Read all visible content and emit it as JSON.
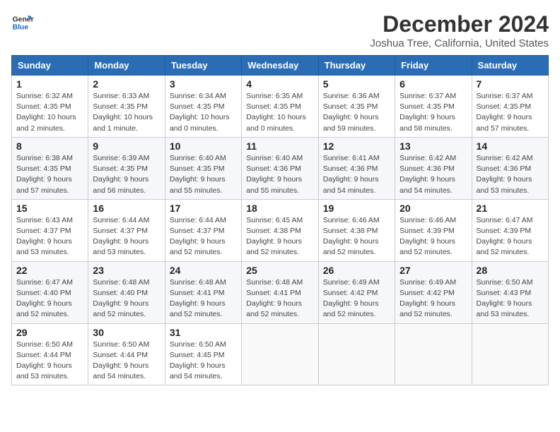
{
  "logo": {
    "line1": "General",
    "line2": "Blue"
  },
  "title": "December 2024",
  "location": "Joshua Tree, California, United States",
  "headers": [
    "Sunday",
    "Monday",
    "Tuesday",
    "Wednesday",
    "Thursday",
    "Friday",
    "Saturday"
  ],
  "weeks": [
    [
      {
        "day": "1",
        "sunrise": "6:32 AM",
        "sunset": "4:35 PM",
        "daylight": "10 hours and 2 minutes."
      },
      {
        "day": "2",
        "sunrise": "6:33 AM",
        "sunset": "4:35 PM",
        "daylight": "10 hours and 1 minute."
      },
      {
        "day": "3",
        "sunrise": "6:34 AM",
        "sunset": "4:35 PM",
        "daylight": "10 hours and 0 minutes."
      },
      {
        "day": "4",
        "sunrise": "6:35 AM",
        "sunset": "4:35 PM",
        "daylight": "10 hours and 0 minutes."
      },
      {
        "day": "5",
        "sunrise": "6:36 AM",
        "sunset": "4:35 PM",
        "daylight": "9 hours and 59 minutes."
      },
      {
        "day": "6",
        "sunrise": "6:37 AM",
        "sunset": "4:35 PM",
        "daylight": "9 hours and 58 minutes."
      },
      {
        "day": "7",
        "sunrise": "6:37 AM",
        "sunset": "4:35 PM",
        "daylight": "9 hours and 57 minutes."
      }
    ],
    [
      {
        "day": "8",
        "sunrise": "6:38 AM",
        "sunset": "4:35 PM",
        "daylight": "9 hours and 57 minutes."
      },
      {
        "day": "9",
        "sunrise": "6:39 AM",
        "sunset": "4:35 PM",
        "daylight": "9 hours and 56 minutes."
      },
      {
        "day": "10",
        "sunrise": "6:40 AM",
        "sunset": "4:35 PM",
        "daylight": "9 hours and 55 minutes."
      },
      {
        "day": "11",
        "sunrise": "6:40 AM",
        "sunset": "4:36 PM",
        "daylight": "9 hours and 55 minutes."
      },
      {
        "day": "12",
        "sunrise": "6:41 AM",
        "sunset": "4:36 PM",
        "daylight": "9 hours and 54 minutes."
      },
      {
        "day": "13",
        "sunrise": "6:42 AM",
        "sunset": "4:36 PM",
        "daylight": "9 hours and 54 minutes."
      },
      {
        "day": "14",
        "sunrise": "6:42 AM",
        "sunset": "4:36 PM",
        "daylight": "9 hours and 53 minutes."
      }
    ],
    [
      {
        "day": "15",
        "sunrise": "6:43 AM",
        "sunset": "4:37 PM",
        "daylight": "9 hours and 53 minutes."
      },
      {
        "day": "16",
        "sunrise": "6:44 AM",
        "sunset": "4:37 PM",
        "daylight": "9 hours and 53 minutes."
      },
      {
        "day": "17",
        "sunrise": "6:44 AM",
        "sunset": "4:37 PM",
        "daylight": "9 hours and 52 minutes."
      },
      {
        "day": "18",
        "sunrise": "6:45 AM",
        "sunset": "4:38 PM",
        "daylight": "9 hours and 52 minutes."
      },
      {
        "day": "19",
        "sunrise": "6:46 AM",
        "sunset": "4:38 PM",
        "daylight": "9 hours and 52 minutes."
      },
      {
        "day": "20",
        "sunrise": "6:46 AM",
        "sunset": "4:39 PM",
        "daylight": "9 hours and 52 minutes."
      },
      {
        "day": "21",
        "sunrise": "6:47 AM",
        "sunset": "4:39 PM",
        "daylight": "9 hours and 52 minutes."
      }
    ],
    [
      {
        "day": "22",
        "sunrise": "6:47 AM",
        "sunset": "4:40 PM",
        "daylight": "9 hours and 52 minutes."
      },
      {
        "day": "23",
        "sunrise": "6:48 AM",
        "sunset": "4:40 PM",
        "daylight": "9 hours and 52 minutes."
      },
      {
        "day": "24",
        "sunrise": "6:48 AM",
        "sunset": "4:41 PM",
        "daylight": "9 hours and 52 minutes."
      },
      {
        "day": "25",
        "sunrise": "6:48 AM",
        "sunset": "4:41 PM",
        "daylight": "9 hours and 52 minutes."
      },
      {
        "day": "26",
        "sunrise": "6:49 AM",
        "sunset": "4:42 PM",
        "daylight": "9 hours and 52 minutes."
      },
      {
        "day": "27",
        "sunrise": "6:49 AM",
        "sunset": "4:42 PM",
        "daylight": "9 hours and 52 minutes."
      },
      {
        "day": "28",
        "sunrise": "6:50 AM",
        "sunset": "4:43 PM",
        "daylight": "9 hours and 53 minutes."
      }
    ],
    [
      {
        "day": "29",
        "sunrise": "6:50 AM",
        "sunset": "4:44 PM",
        "daylight": "9 hours and 53 minutes."
      },
      {
        "day": "30",
        "sunrise": "6:50 AM",
        "sunset": "4:44 PM",
        "daylight": "9 hours and 54 minutes."
      },
      {
        "day": "31",
        "sunrise": "6:50 AM",
        "sunset": "4:45 PM",
        "daylight": "9 hours and 54 minutes."
      },
      null,
      null,
      null,
      null
    ]
  ],
  "labels": {
    "sunrise": "Sunrise:",
    "sunset": "Sunset:",
    "daylight": "Daylight:"
  }
}
